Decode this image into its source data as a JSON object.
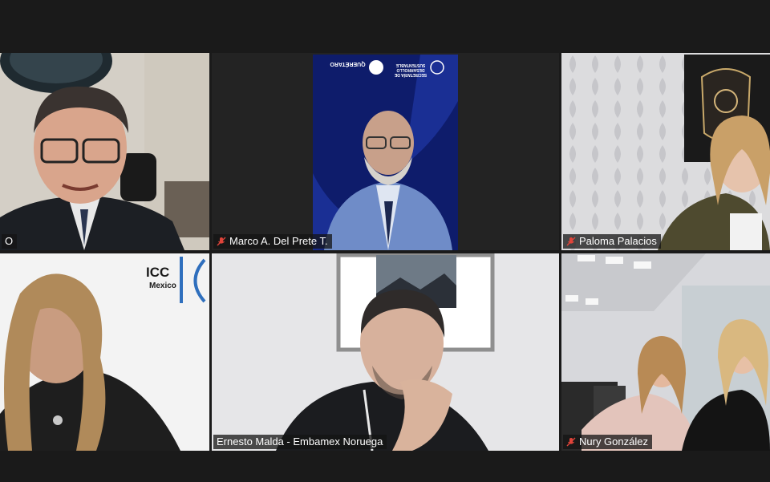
{
  "tiles": [
    {
      "name": "O",
      "muted": false,
      "active": true
    },
    {
      "name": "Marco A. Del Prete T.",
      "muted": true,
      "active": false,
      "banner_text_1": "QUERÉTARO",
      "banner_text_2": "SECRETARÍA DE DESARROLLO SUSTENTABLE"
    },
    {
      "name": "Paloma Palacios",
      "muted": true,
      "active": false
    },
    {
      "name": "",
      "muted": false,
      "active": false,
      "logo_text_1": "ICC",
      "logo_text_2": "Mexico"
    },
    {
      "name": "Ernesto Malda - Embamex Noruega",
      "muted": false,
      "active": false
    },
    {
      "name": "Nury González",
      "muted": true,
      "active": false
    }
  ],
  "colors": {
    "active_border": "#b8e04a",
    "mute_red": "#e0443a",
    "background": "#1a1a1a"
  }
}
